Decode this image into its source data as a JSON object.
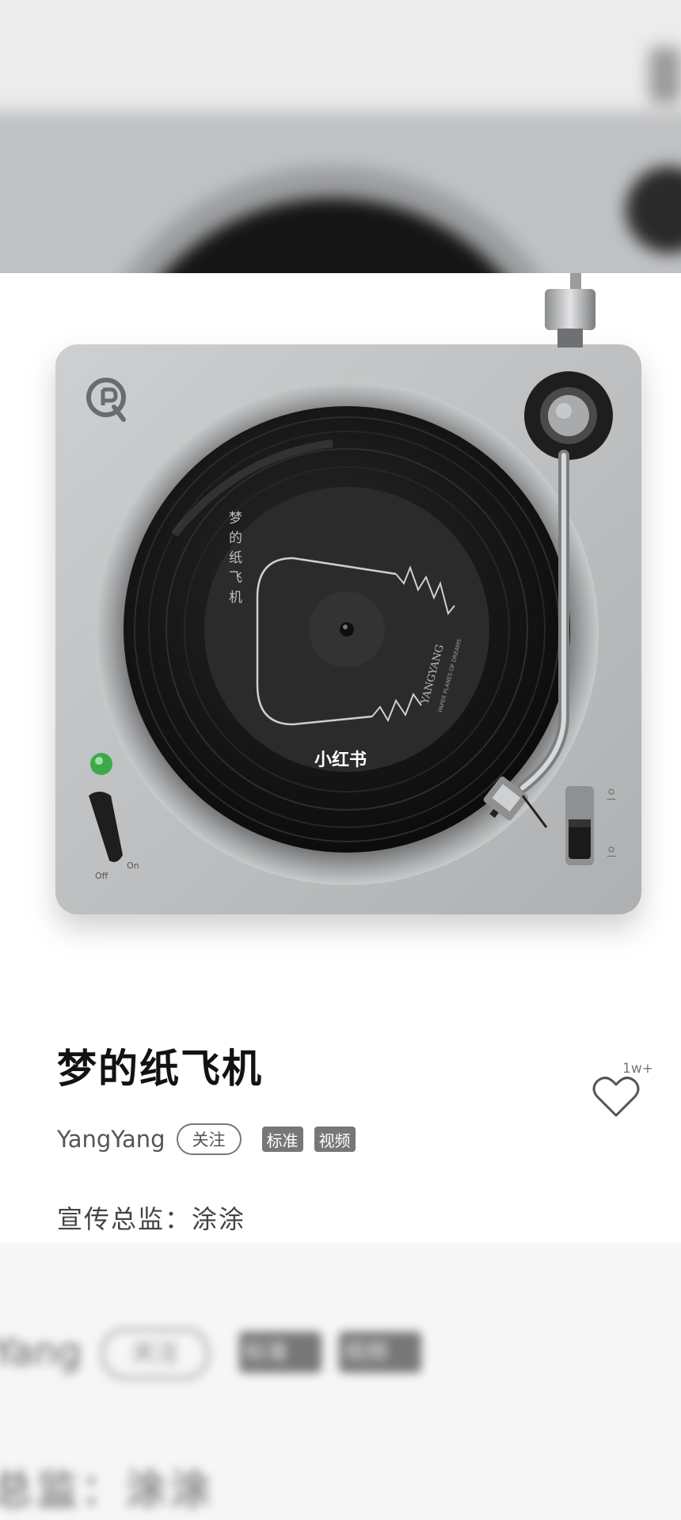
{
  "watermark": "小红书",
  "song": {
    "title": "梦的纸飞机",
    "artist": "YangYang",
    "follow_label": "关注",
    "tags": [
      "标准",
      "视频"
    ],
    "credit": "宣传总监：涂涂"
  },
  "likes": {
    "count": "1w+",
    "icon": "heart-outline-icon"
  },
  "record_label": {
    "title_vertical": "梦的纸飞机",
    "artist": "YANGYANG",
    "subtitle": "PAPER PLANES OF DREAMS"
  },
  "turntable": {
    "power_off_label": "Off",
    "power_on_label": "On",
    "logo_icon": "q-logo-icon",
    "indicator_color": "#3fa84a"
  },
  "background_echo": {
    "artist_fragment": "Yang",
    "follow_label": "关注",
    "tags": [
      "标准",
      "视频"
    ],
    "credit_fragment": "总监：涂涂"
  }
}
